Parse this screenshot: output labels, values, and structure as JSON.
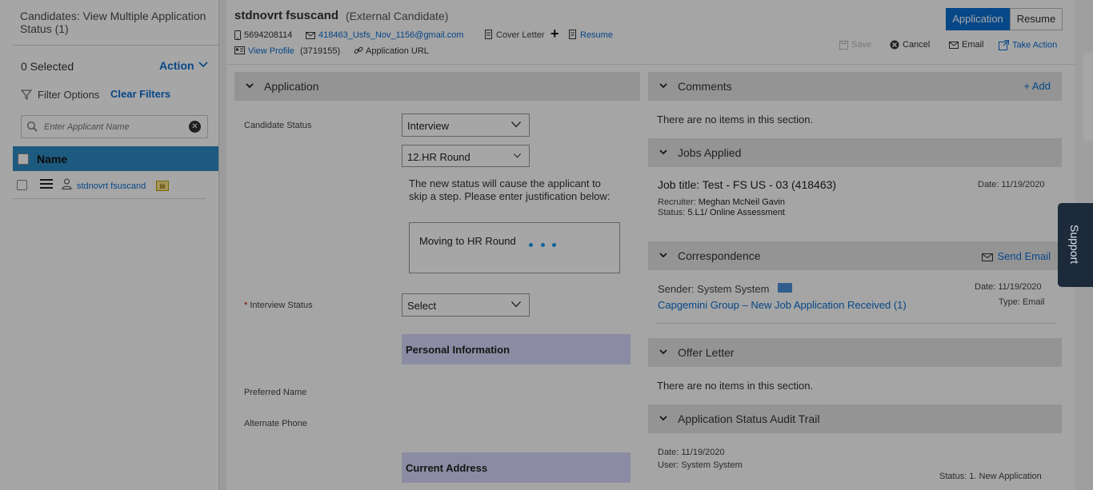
{
  "left_panel": {
    "title": "Candidates: View Multiple Application Status (1)",
    "selected_count": "0 Selected",
    "action_label": "Action",
    "filter_label": "Filter Options",
    "clear_filters": "Clear Filters",
    "search_placeholder": "Enter Applicant Name",
    "name_header": "Name",
    "rows": [
      {
        "name": "stdnovrt fsuscand"
      }
    ]
  },
  "candidate": {
    "name": "stdnovrt fsuscand",
    "type": "(External Candidate)",
    "phone": "5694208114",
    "email": "418463_Usfs_Nov_1156@gmail.com",
    "cover_letter": "Cover Letter",
    "plus": "+",
    "resume": "Resume",
    "view_profile": "View Profile",
    "profile_id": "(3719155)",
    "application_url": "Application URL"
  },
  "header_tabs": {
    "application": "Application",
    "resume": "Resume"
  },
  "header_actions": {
    "save": "Save",
    "cancel": "Cancel",
    "email": "Email",
    "take_action": "Take Action"
  },
  "application": {
    "section_title": "Application",
    "candidate_status_label": "Candidate Status",
    "candidate_status_value": "Interview",
    "round_value": "12.HR Round",
    "warning": "The new status will cause the applicant to skip a step. Please enter justification below:",
    "justification": "Moving to HR Round",
    "interview_status_label": "Interview Status",
    "interview_status_required": "*",
    "interview_status_value": "Select",
    "personal_information": "Personal Information",
    "preferred_name_label": "Preferred Name",
    "alternate_phone_label": "Alternate Phone",
    "current_address": "Current Address"
  },
  "comments": {
    "title": "Comments",
    "add": "+ Add",
    "empty": "There are no items in this section."
  },
  "jobs_applied": {
    "title": "Jobs Applied",
    "job_title": "Job title: Test - FS US - 03 (418463)",
    "date": "Date: 11/19/2020",
    "recruiter_label": "Recruiter:",
    "recruiter": "Meghan McNeil Gavin",
    "status_label": "Status:",
    "status": "5.L1/ Online Assessment"
  },
  "correspondence": {
    "title": "Correspondence",
    "send_email": "Send Email",
    "sender": "Sender: System System",
    "date": "Date: 11/19/2020",
    "subject": "Capgemini Group – New Job Application Received (1)",
    "type": "Type: Email"
  },
  "offer_letter": {
    "title": "Offer Letter",
    "empty": "There are no items in this section."
  },
  "audit_trail": {
    "title": "Application Status Audit Trail",
    "date": "Date: 11/19/2020",
    "user": "User: System System",
    "status": "Status: 1. New Application"
  },
  "support": {
    "label": "Support"
  },
  "colors": {
    "accent": "#0a6ed1",
    "header_bar": "#2d8ac3",
    "section_box": "#d6d6fa",
    "support_tab": "#1c2a3a"
  }
}
